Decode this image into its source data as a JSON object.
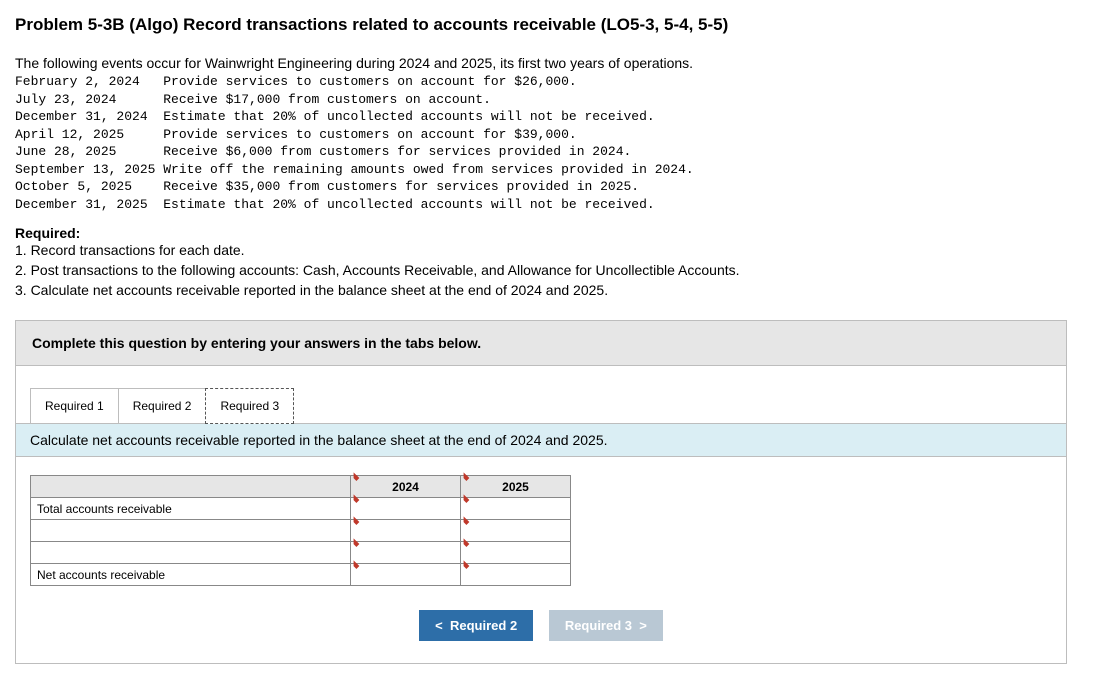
{
  "title": "Problem 5-3B (Algo) Record transactions related to accounts receivable (LO5-3, 5-4, 5-5)",
  "intro": "The following events occur for Wainwright Engineering during 2024 and 2025, its first two years of operations.",
  "events": [
    {
      "date": "February 2, 2024",
      "desc": "Provide services to customers on account for $26,000."
    },
    {
      "date": "July 23, 2024",
      "desc": "Receive $17,000 from customers on account."
    },
    {
      "date": "December 31, 2024",
      "desc": "Estimate that 20% of uncollected accounts will not be received."
    },
    {
      "date": "April 12, 2025",
      "desc": "Provide services to customers on account for $39,000."
    },
    {
      "date": "June 28, 2025",
      "desc": "Receive $6,000 from customers for services provided in 2024."
    },
    {
      "date": "September 13, 2025",
      "desc": "Write off the remaining amounts owed from services provided in 2024."
    },
    {
      "date": "October 5, 2025",
      "desc": "Receive $35,000 from customers for services provided in 2025."
    },
    {
      "date": "December 31, 2025",
      "desc": "Estimate that 20% of uncollected accounts will not be received."
    }
  ],
  "required_head": "Required:",
  "required": [
    "1. Record transactions for each date.",
    "2. Post transactions to the following accounts: Cash, Accounts Receivable, and Allowance for Uncollectible Accounts.",
    "3. Calculate net accounts receivable reported in the balance sheet at the end of 2024 and 2025."
  ],
  "panel_instruction": "Complete this question by entering your answers in the tabs below.",
  "tabs": {
    "t1": "Required 1",
    "t2": "Required 2",
    "t3": "Required 3"
  },
  "sub_instruction": "Calculate net accounts receivable reported in the balance sheet at the end of 2024 and 2025.",
  "table": {
    "col1": "2024",
    "col2": "2025",
    "row1": "Total accounts receivable",
    "row2": "",
    "row3": "",
    "row4": "Net accounts receivable"
  },
  "nav": {
    "prev": "Required 2",
    "next": "Required 3"
  }
}
